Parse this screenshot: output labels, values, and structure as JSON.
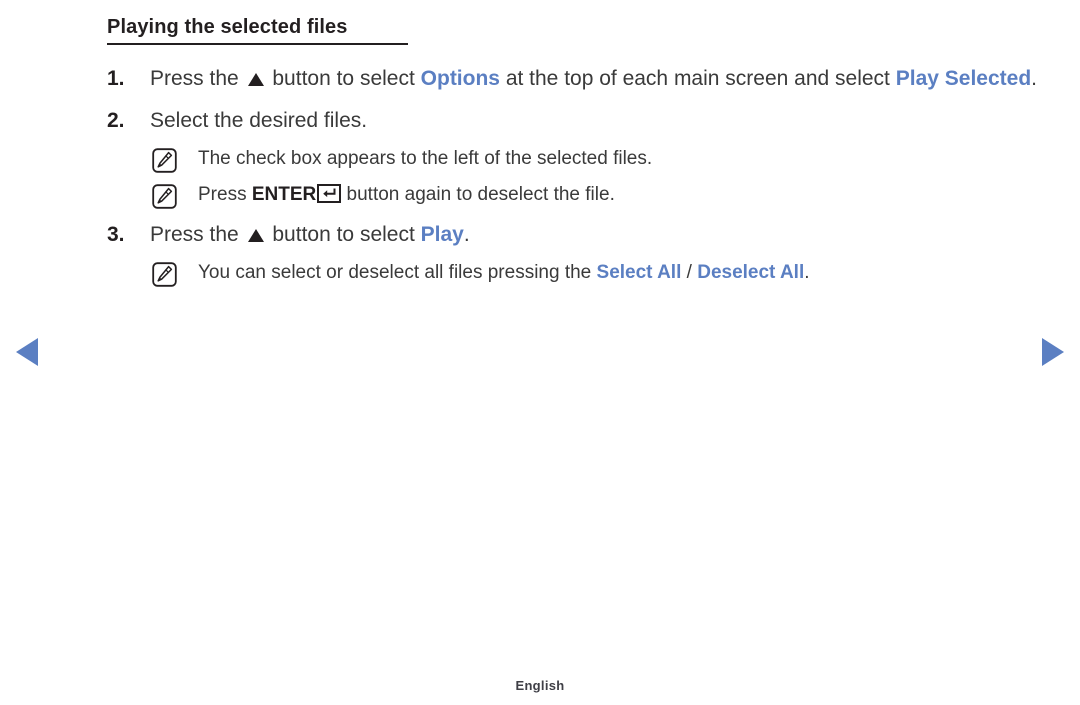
{
  "colors": {
    "accent_blue": "#5b7fc2",
    "text": "#3a3a3a",
    "heading": "#231f20",
    "background": "#ffffff"
  },
  "heading": {
    "title": "Playing the selected files"
  },
  "steps": [
    {
      "number": "1.",
      "parts": [
        {
          "type": "text",
          "value": "Press the "
        },
        {
          "type": "icon",
          "value": "triangle-up-icon"
        },
        {
          "type": "text",
          "value": " button to select "
        },
        {
          "type": "keyword",
          "value": "Options"
        },
        {
          "type": "text",
          "value": " at the top of each main screen and select "
        },
        {
          "type": "keyword",
          "value": "Play Selected"
        },
        {
          "type": "text",
          "value": "."
        }
      ],
      "plain": "Press the ▲ button to select Options at the top of each main screen and select Play Selected."
    },
    {
      "number": "2.",
      "parts": [
        {
          "type": "text",
          "value": "Select the desired files."
        }
      ],
      "plain": "Select the desired files."
    },
    {
      "number": "3.",
      "parts": [
        {
          "type": "text",
          "value": "Press the "
        },
        {
          "type": "icon",
          "value": "triangle-up-icon"
        },
        {
          "type": "text",
          "value": " button to select "
        },
        {
          "type": "keyword",
          "value": "Play"
        },
        {
          "type": "text",
          "value": "."
        }
      ],
      "plain": "Press the ▲ button to select Play."
    }
  ],
  "notes": {
    "icon_name": "note-pencil-icon",
    "checkbox_note": {
      "text": "The check box appears to the left of the selected files."
    },
    "enter_note": {
      "before": "Press ",
      "key_label": "ENTER",
      "key_symbol": "return-arrow-icon",
      "after": " button again to deselect the file."
    },
    "select_all_note": {
      "before": "You can select or deselect all files pressing the ",
      "keyword_1": "Select All",
      "separator": " / ",
      "keyword_2": "Deselect All",
      "after": "."
    }
  },
  "navigation": {
    "prev_label": "previous-page-arrow",
    "next_label": "next-page-arrow"
  },
  "footer": {
    "language": "English"
  }
}
